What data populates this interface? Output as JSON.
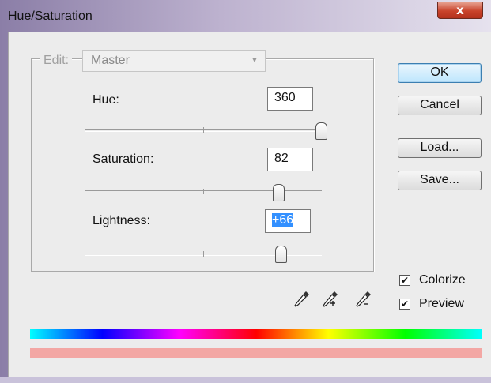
{
  "window": {
    "title": "Hue/Saturation",
    "close_glyph": "x"
  },
  "edit": {
    "label": "Edit:",
    "value": "Master"
  },
  "sliders": {
    "hue": {
      "label": "Hue:",
      "value": "360",
      "level": 1.0
    },
    "saturation": {
      "label": "Saturation:",
      "value": "82",
      "level": 0.82
    },
    "lightness": {
      "label": "Lightness:",
      "value": "+66",
      "level": 0.83
    }
  },
  "buttons": {
    "ok": "OK",
    "cancel": "Cancel",
    "load": "Load...",
    "save": "Save..."
  },
  "options": {
    "colorize": {
      "label": "Colorize",
      "checked": true
    },
    "preview": {
      "label": "Preview",
      "checked": true
    }
  },
  "icons": {
    "eyedropper": "eyedropper-icon",
    "eyedropper_add": "eyedropper-plus-icon",
    "eyedropper_subtract": "eyedropper-minus-icon",
    "dropdown_arrow": "chevron-down-icon",
    "check": "✔"
  },
  "colors": {
    "accent": "#3390ff",
    "colorize_bar": "#f3a7a4",
    "close_button": "#c9432b"
  }
}
